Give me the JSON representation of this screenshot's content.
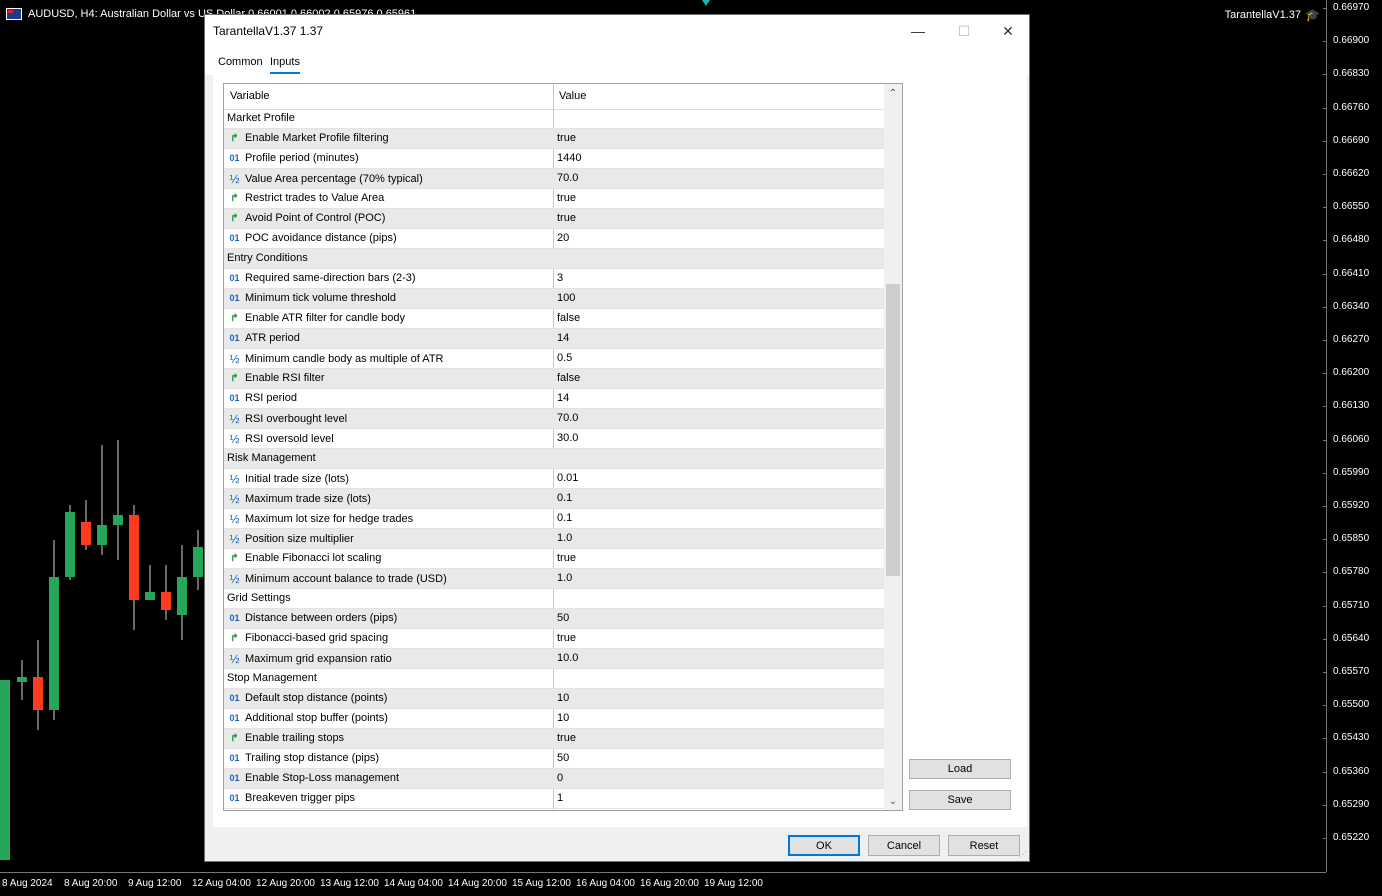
{
  "chart": {
    "symbol_text": "AUDUSD, H4:  Australian Dollar vs US Dollar  0.66001 0.66002 0.65976 0.65961",
    "ea_label": "TarantellaV1.37",
    "price_labels": [
      "0.66970",
      "0.66900",
      "0.66830",
      "0.66760",
      "0.66690",
      "0.66620",
      "0.66550",
      "0.66480",
      "0.66410",
      "0.66340",
      "0.66270",
      "0.66200",
      "0.66130",
      "0.66060",
      "0.65990",
      "0.65920",
      "0.65850",
      "0.65780",
      "0.65710",
      "0.65640",
      "0.65570",
      "0.65500",
      "0.65430",
      "0.65360",
      "0.65290",
      "0.65220"
    ],
    "time_labels": [
      "8 Aug 2024",
      "8 Aug 20:00",
      "9 Aug 12:00",
      "12 Aug 04:00",
      "12 Aug 20:00",
      "13 Aug 12:00",
      "14 Aug 04:00",
      "14 Aug 20:00",
      "15 Aug 12:00",
      "16 Aug 04:00",
      "16 Aug 20:00",
      "19 Aug 12:00"
    ],
    "colors": {
      "bull": "#26a65b",
      "bear": "#ff3b1f",
      "wick": "#cfcfcf"
    }
  },
  "dialog": {
    "title": "TarantellaV1.37 1.37",
    "minimize_glyph": "—",
    "maximize_glyph": "☐",
    "close_glyph": "✕",
    "tabs": [
      "Common",
      "Inputs"
    ],
    "active_tab": "Inputs",
    "columns": {
      "variable": "Variable",
      "value": "Value"
    },
    "rows": [
      {
        "type": "group",
        "label": "Market Profile",
        "value": ""
      },
      {
        "type": "bool",
        "label": "Enable Market Profile filtering",
        "value": "true"
      },
      {
        "type": "int",
        "label": "Profile period (minutes)",
        "value": "1440"
      },
      {
        "type": "dbl",
        "label": "Value Area percentage (70% typical)",
        "value": "70.0"
      },
      {
        "type": "bool",
        "label": "Restrict trades to Value Area",
        "value": "true"
      },
      {
        "type": "bool",
        "label": "Avoid Point of Control (POC)",
        "value": "true"
      },
      {
        "type": "int",
        "label": "POC avoidance distance (pips)",
        "value": "20"
      },
      {
        "type": "group",
        "label": "Entry Conditions",
        "value": ""
      },
      {
        "type": "int",
        "label": "Required same-direction bars (2-3)",
        "value": "3"
      },
      {
        "type": "int",
        "label": "Minimum tick volume threshold",
        "value": "100"
      },
      {
        "type": "bool",
        "label": "Enable ATR filter for candle body",
        "value": "false"
      },
      {
        "type": "int",
        "label": "ATR period",
        "value": "14"
      },
      {
        "type": "dbl",
        "label": "Minimum candle body as multiple of ATR",
        "value": "0.5"
      },
      {
        "type": "bool",
        "label": "Enable RSI filter",
        "value": "false"
      },
      {
        "type": "int",
        "label": "RSI period",
        "value": "14"
      },
      {
        "type": "dbl",
        "label": "RSI overbought level",
        "value": "70.0"
      },
      {
        "type": "dbl",
        "label": "RSI oversold level",
        "value": "30.0"
      },
      {
        "type": "group",
        "label": "Risk Management",
        "value": ""
      },
      {
        "type": "dbl",
        "label": "Initial trade size (lots)",
        "value": "0.01"
      },
      {
        "type": "dbl",
        "label": "Maximum trade size (lots)",
        "value": "0.1"
      },
      {
        "type": "dbl",
        "label": "Maximum lot size for hedge trades",
        "value": "0.1"
      },
      {
        "type": "dbl",
        "label": "Position size multiplier",
        "value": "1.0"
      },
      {
        "type": "bool",
        "label": "Enable Fibonacci lot scaling",
        "value": "true"
      },
      {
        "type": "dbl",
        "label": "Minimum account balance to trade (USD)",
        "value": "1.0"
      },
      {
        "type": "group",
        "label": "Grid Settings",
        "value": ""
      },
      {
        "type": "int",
        "label": "Distance between orders (pips)",
        "value": "50"
      },
      {
        "type": "bool",
        "label": "Fibonacci-based grid spacing",
        "value": "true"
      },
      {
        "type": "dbl",
        "label": "Maximum grid expansion ratio",
        "value": "10.0"
      },
      {
        "type": "group",
        "label": "Stop Management",
        "value": ""
      },
      {
        "type": "int",
        "label": "Default stop distance (points)",
        "value": "10"
      },
      {
        "type": "int",
        "label": "Additional stop buffer (points)",
        "value": "10"
      },
      {
        "type": "bool",
        "label": "Enable trailing stops",
        "value": "true"
      },
      {
        "type": "int",
        "label": "Trailing stop distance (pips)",
        "value": "50"
      },
      {
        "type": "int",
        "label": "Enable Stop-Loss management",
        "value": "0"
      },
      {
        "type": "int",
        "label": "Breakeven trigger pips",
        "value": "1"
      }
    ],
    "icons": {
      "bool": "↱",
      "int": "01",
      "dbl": "½"
    },
    "buttons": {
      "load": "Load",
      "save": "Save",
      "ok": "OK",
      "cancel": "Cancel",
      "reset": "Reset"
    }
  }
}
